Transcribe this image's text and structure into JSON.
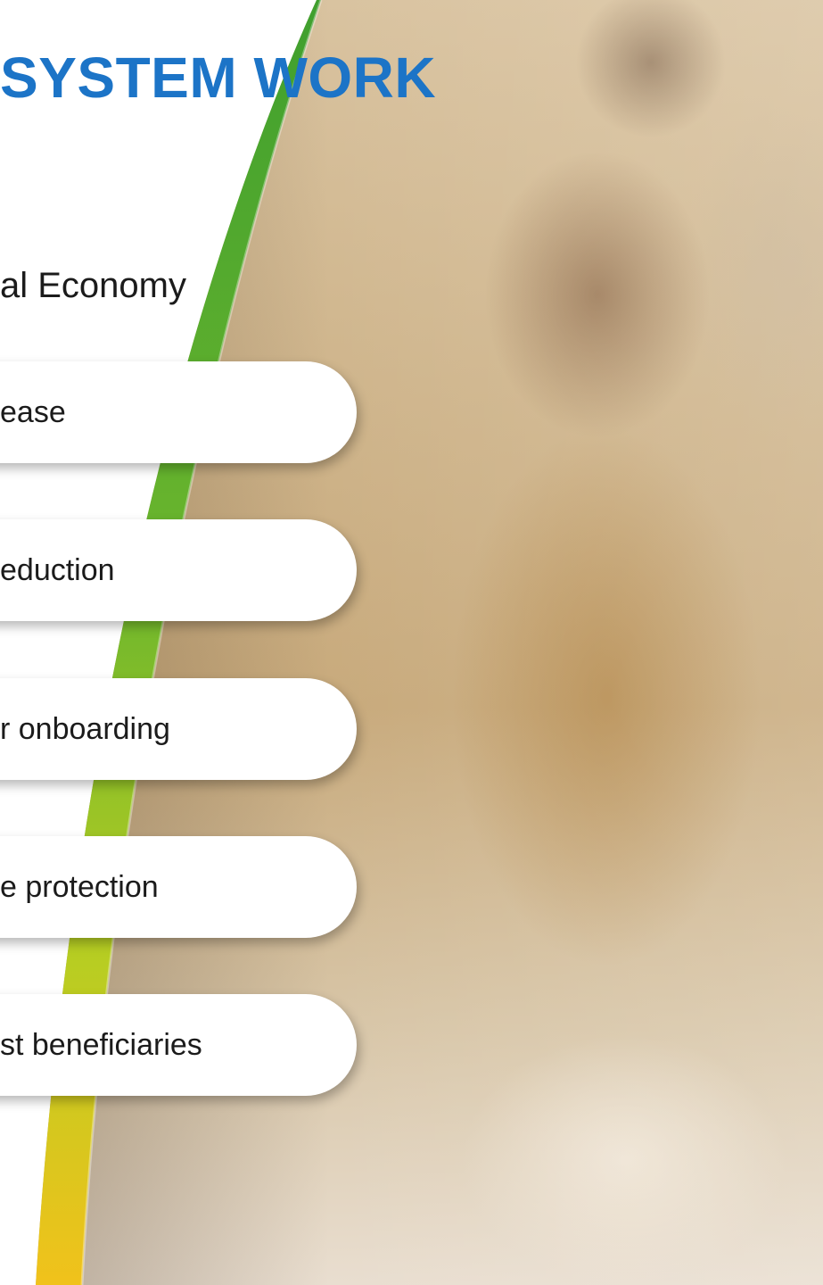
{
  "header": {
    "title": "SYSTEM WORK",
    "subtitle": "al Economy"
  },
  "items": [
    {
      "label": "ease"
    },
    {
      "label": "eduction"
    },
    {
      "label": "r onboarding"
    },
    {
      "label": "e protection"
    },
    {
      "label": "st beneficiaries"
    }
  ],
  "colors": {
    "title": "#1c74c7",
    "curve_green": "#4caf2e",
    "curve_yellow": "#f1c21b",
    "text": "#1b1b1b",
    "pill_bg": "#ffffff"
  }
}
